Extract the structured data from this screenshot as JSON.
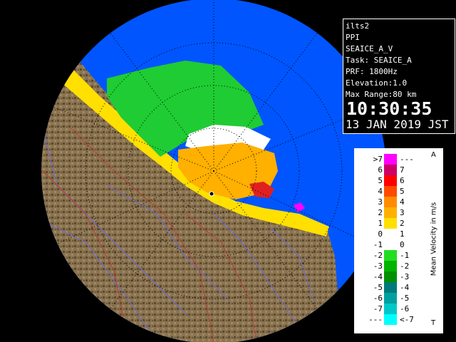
{
  "info": {
    "station": "ilts2",
    "product": "PPI",
    "scan": "SEAICE_A_V",
    "task": "Task: SEAICE_A",
    "prf": "PRF: 1800Hz",
    "elevation": "Elevation:1.0",
    "max_range": "Max Range:80 km",
    "time": "10:30:35",
    "date": "13 JAN 2019 JST"
  },
  "legend": {
    "title": "Mean Velocity in m/s",
    "top_marker": "A",
    "bottom_marker": "T",
    "rows": [
      {
        "left": ">7",
        "right": "---",
        "color": "#ff00ff"
      },
      {
        "left": "6",
        "right": "7",
        "color": "#cc0066"
      },
      {
        "left": "5",
        "right": "6",
        "color": "#ff0000"
      },
      {
        "left": "4",
        "right": "5",
        "color": "#ff4a00"
      },
      {
        "left": "3",
        "right": "4",
        "color": "#ff8c00"
      },
      {
        "left": "2",
        "right": "3",
        "color": "#ffb000"
      },
      {
        "left": "1",
        "right": "2",
        "color": "#ffe000"
      },
      {
        "left": "0",
        "right": "1",
        "color": "#ffffff"
      },
      {
        "left": "-1",
        "right": "0",
        "color": "#ffffff"
      },
      {
        "left": "-2",
        "right": "-1",
        "color": "#22dd22"
      },
      {
        "left": "-3",
        "right": "-2",
        "color": "#00b400"
      },
      {
        "left": "-4",
        "right": "-3",
        "color": "#009000"
      },
      {
        "left": "-5",
        "right": "-4",
        "color": "#007a7a"
      },
      {
        "left": "-6",
        "right": "-5",
        "color": "#00a0a0"
      },
      {
        "left": "-7",
        "right": "-6",
        "color": "#00c8c8"
      },
      {
        "left": "---",
        "right": "<-7",
        "color": "#00ffff"
      }
    ]
  },
  "colors": {
    "ocean": "#0055ff",
    "terrain": "#8a7350",
    "range_ring": "#000000"
  }
}
